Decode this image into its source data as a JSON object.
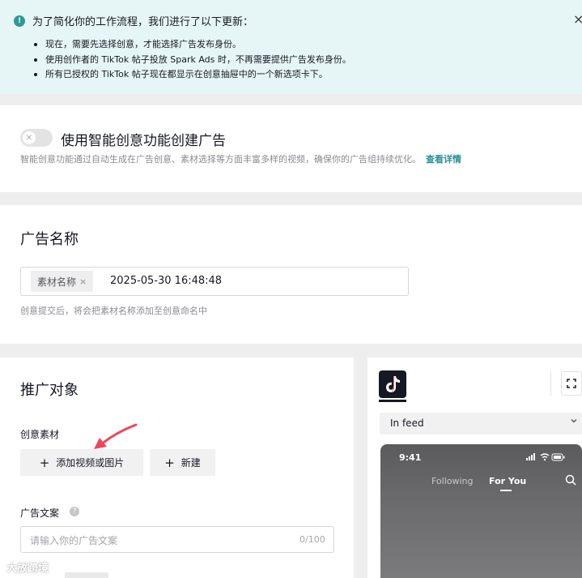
{
  "notice": {
    "icon_label": "!",
    "title": "为了简化你的工作流程，我们进行了以下更新：",
    "items": [
      "现在，需要先选择创意，才能选择广告发布身份。",
      "使用创作者的 TikTok 帖子投放 Spark Ads 时，不再需要提供广告发布身份。",
      "所有已授权的 TikTok 帖子现在都显示在创意抽屉中的一个新选项卡下。"
    ],
    "close": "×"
  },
  "smart_creative": {
    "toggle_on": false,
    "title": "使用智能创意功能创建广告",
    "description": "智能创意功能通过自动生成在广告创意、素材选择等方面丰富多样的视频，确保你的广告组持续优化。",
    "link": "查看详情"
  },
  "ad_name": {
    "title": "广告名称",
    "chip": "素材名称",
    "chip_remove": "×",
    "value": "2025-05-30 16:48:48",
    "hint": "创意提交后，将会把素材名称添加至创意命名中"
  },
  "promotion": {
    "title": "推广对象",
    "creative_label": "创意素材",
    "add_media_button": "添加视频或图片",
    "new_button": "新建",
    "plus": "+",
    "copy_label": "广告文案",
    "help": "?",
    "copy_placeholder": "请输入你的广告文案",
    "copy_counter": "0/100"
  },
  "preview": {
    "placement": "In feed",
    "phone_time": "9:41",
    "tabs": [
      "Following",
      "For You"
    ],
    "active_tab": "For You"
  },
  "watermark": "大放跨境",
  "colors": {
    "notice_bg": "#e6f6f6",
    "accent": "#2a8f97",
    "annotation_arrow": "#f0455a"
  }
}
